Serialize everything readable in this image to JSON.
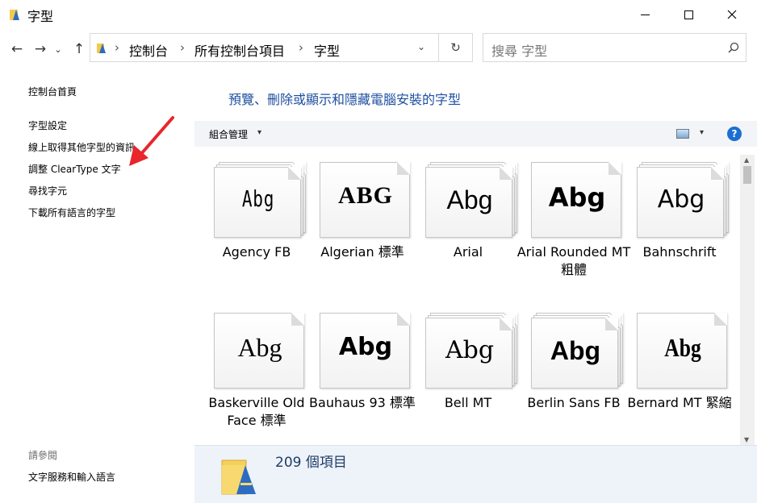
{
  "window": {
    "title": "字型"
  },
  "nav": {
    "back_label": "←",
    "forward_label": "→",
    "recent_label": "⌄",
    "up_label": "↑"
  },
  "address": {
    "crumbs": [
      "控制台",
      "所有控制台項目",
      "字型"
    ],
    "separator": "›",
    "dropdown": "⌄",
    "refresh": "↻"
  },
  "search": {
    "placeholder": "搜尋 字型"
  },
  "sidebar": {
    "items": [
      {
        "label": "控制台首頁"
      },
      {
        "label": "字型設定"
      },
      {
        "label": "線上取得其他字型的資訊"
      },
      {
        "label": "調整 ClearType 文字"
      },
      {
        "label": "尋找字元"
      },
      {
        "label": "下載所有語言的字型"
      }
    ],
    "see_also_heading": "請參閱",
    "see_also_items": [
      {
        "label": "文字服務和輸入語言"
      }
    ]
  },
  "main": {
    "heading": "預覽、刪除或顯示和隱藏電腦安裝的字型",
    "toolbar": {
      "organize_label": "組合管理",
      "caret": "▾",
      "help_label": "?"
    },
    "fonts": [
      {
        "name": "Agency FB",
        "sample": "Abg",
        "style": "f-agency",
        "stacked": true
      },
      {
        "name": "Algerian 標準",
        "sample": "ABG",
        "style": "f-algerian",
        "stacked": false
      },
      {
        "name": "Arial",
        "sample": "Abg",
        "style": "f-arial",
        "stacked": true
      },
      {
        "name": "Arial Rounded MT 粗體",
        "sample": "Abg",
        "style": "f-arialround",
        "stacked": false
      },
      {
        "name": "Bahnschrift",
        "sample": "Abg",
        "style": "f-bahn",
        "stacked": true
      },
      {
        "name": "Baskerville Old Face 標準",
        "sample": "Abg",
        "style": "f-baskerville",
        "stacked": false
      },
      {
        "name": "Bauhaus 93 標準",
        "sample": "Abg",
        "style": "f-bauhaus",
        "stacked": false
      },
      {
        "name": "Bell MT",
        "sample": "Abg",
        "style": "f-bell",
        "stacked": true
      },
      {
        "name": "Berlin Sans FB",
        "sample": "Abg",
        "style": "f-berlin",
        "stacked": true
      },
      {
        "name": "Bernard MT 緊縮",
        "sample": "Abg",
        "style": "f-bernard",
        "stacked": false
      }
    ]
  },
  "details": {
    "count": "209 個項目"
  },
  "colors": {
    "heading": "#1e4fa0",
    "toolbar_bg": "#f2f4f7",
    "details_bg": "#eef3fa",
    "annotation_arrow": "#e8262b"
  }
}
